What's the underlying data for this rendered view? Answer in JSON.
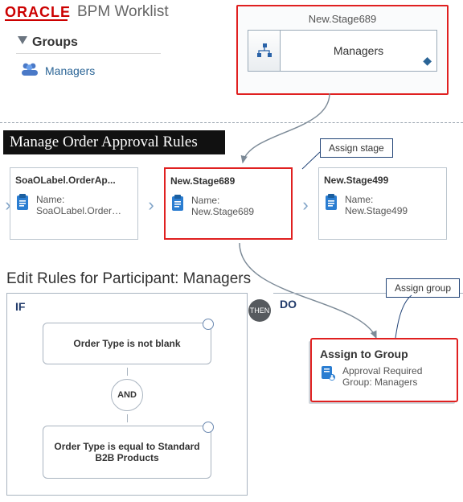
{
  "header": {
    "brand": "ORACLE",
    "app": "BPM Worklist"
  },
  "groups": {
    "title": "Groups",
    "items": [
      {
        "label": "Managers"
      }
    ]
  },
  "worklist_stage": {
    "title": "New.Stage689",
    "participant": "Managers"
  },
  "rules_page_title": "Manage Order Approval Rules",
  "callouts": {
    "assign_stage": "Assign stage",
    "assign_group": "Assign group"
  },
  "stages": [
    {
      "title": "SoaOLabel.OrderAp...",
      "name_label": "Name:",
      "name_value": "SoaOLabel.Order…"
    },
    {
      "title": "New.Stage689",
      "name_label": "Name:",
      "name_value": "New.Stage689"
    },
    {
      "title": "New.Stage499",
      "name_label": "Name:",
      "name_value": "New.Stage499"
    }
  ],
  "edit_rules_title": "Edit Rules for Participant: Managers",
  "rule": {
    "if_label": "IF",
    "then_label": "THEN",
    "do_label": "DO",
    "and_label": "AND",
    "conditions": [
      "Order Type is not blank",
      "Order Type is equal to Standard B2B Products"
    ],
    "action": {
      "title": "Assign to Group",
      "line": "Approval Required Group: Managers"
    }
  }
}
